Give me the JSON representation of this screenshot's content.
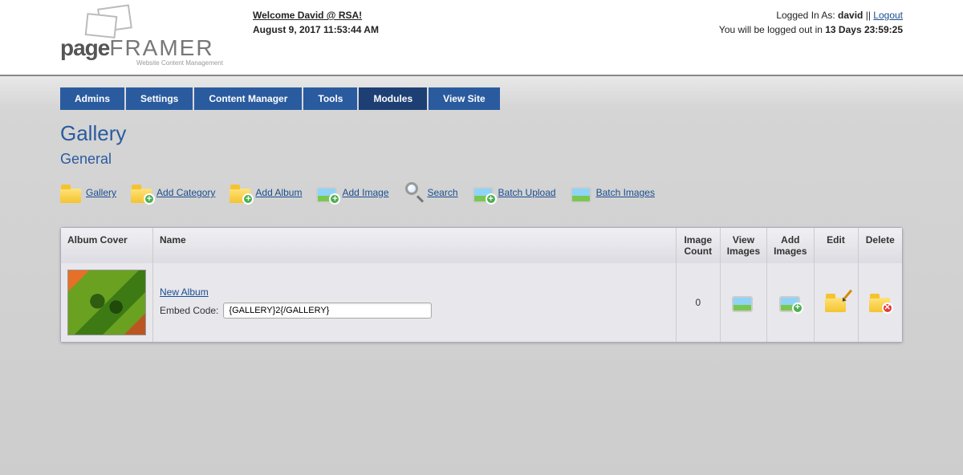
{
  "header": {
    "welcome_text": "Welcome David @ RSA!",
    "date_text": "August 9, 2017 11:53:44 AM",
    "logged_in_prefix": "Logged In As: ",
    "username": "david",
    "separator": " || ",
    "logout_label": "Logout",
    "timeout_prefix": "You will be logged out in ",
    "timeout_value": "13 Days 23:59:25",
    "logo_main_1": "page",
    "logo_main_2": "FRAMER",
    "logo_sub": "Website Content Management"
  },
  "nav": {
    "tabs": [
      "Admins",
      "Settings",
      "Content Manager",
      "Tools",
      "Modules",
      "View Site"
    ],
    "active_index": 4
  },
  "page": {
    "title": "Gallery",
    "subtitle": "General"
  },
  "actions": {
    "gallery": "Gallery",
    "add_category": "Add Category",
    "add_album": "Add Album",
    "add_image": "Add Image",
    "search": "Search",
    "batch_upload": "Batch Upload",
    "batch_images": "Batch Images"
  },
  "table": {
    "headers": {
      "album_cover": "Album Cover",
      "name": "Name",
      "image_count": "Image Count",
      "view_images": "View Images",
      "add_images": "Add Images",
      "edit": "Edit",
      "delete": "Delete"
    },
    "rows": [
      {
        "name_link": "New Album",
        "embed_label": "Embed Code:",
        "embed_value": "{GALLERY}2{/GALLERY}",
        "image_count": "0"
      }
    ]
  }
}
